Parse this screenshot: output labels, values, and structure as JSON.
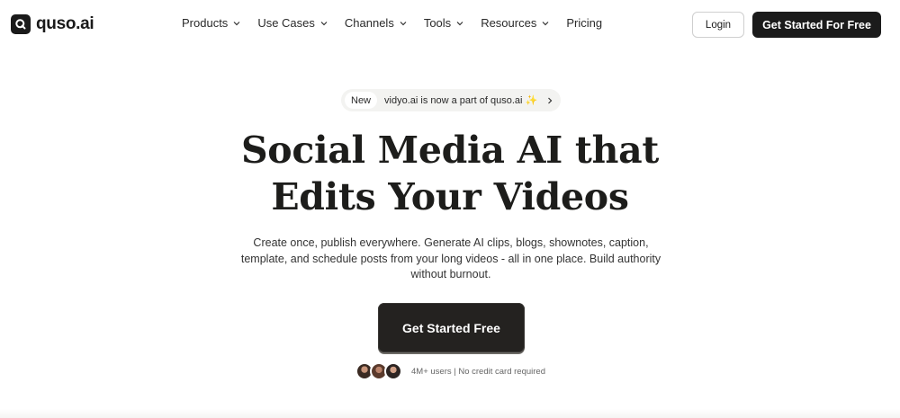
{
  "brand": {
    "name": "quso.ai"
  },
  "nav": {
    "items": [
      {
        "label": "Products",
        "has_dropdown": true
      },
      {
        "label": "Use Cases",
        "has_dropdown": true
      },
      {
        "label": "Channels",
        "has_dropdown": true
      },
      {
        "label": "Tools",
        "has_dropdown": true
      },
      {
        "label": "Resources",
        "has_dropdown": true
      },
      {
        "label": "Pricing",
        "has_dropdown": false
      }
    ],
    "login_label": "Login",
    "cta_label": "Get Started For Free"
  },
  "announcement": {
    "badge": "New",
    "text": "vidyo.ai is now a part of quso.ai",
    "icon": "sparkle-icon"
  },
  "hero": {
    "title_line1": "Social Media AI that",
    "title_line2": "Edits Your Videos",
    "subtitle_line1": "Create once, publish everywhere. Generate AI clips, blogs, shownotes, caption,",
    "subtitle_line2": "template, and schedule posts from your long videos - all in one place. Build authority",
    "subtitle_line3": "without burnout.",
    "cta_label": "Get Started Free",
    "social_proof": "4M+ users | No credit card required"
  },
  "colors": {
    "primary_button": "#1b1b1b",
    "background": "#ffffff",
    "pill_background": "#f3f3f1",
    "sparkle": "#f0b52a"
  }
}
